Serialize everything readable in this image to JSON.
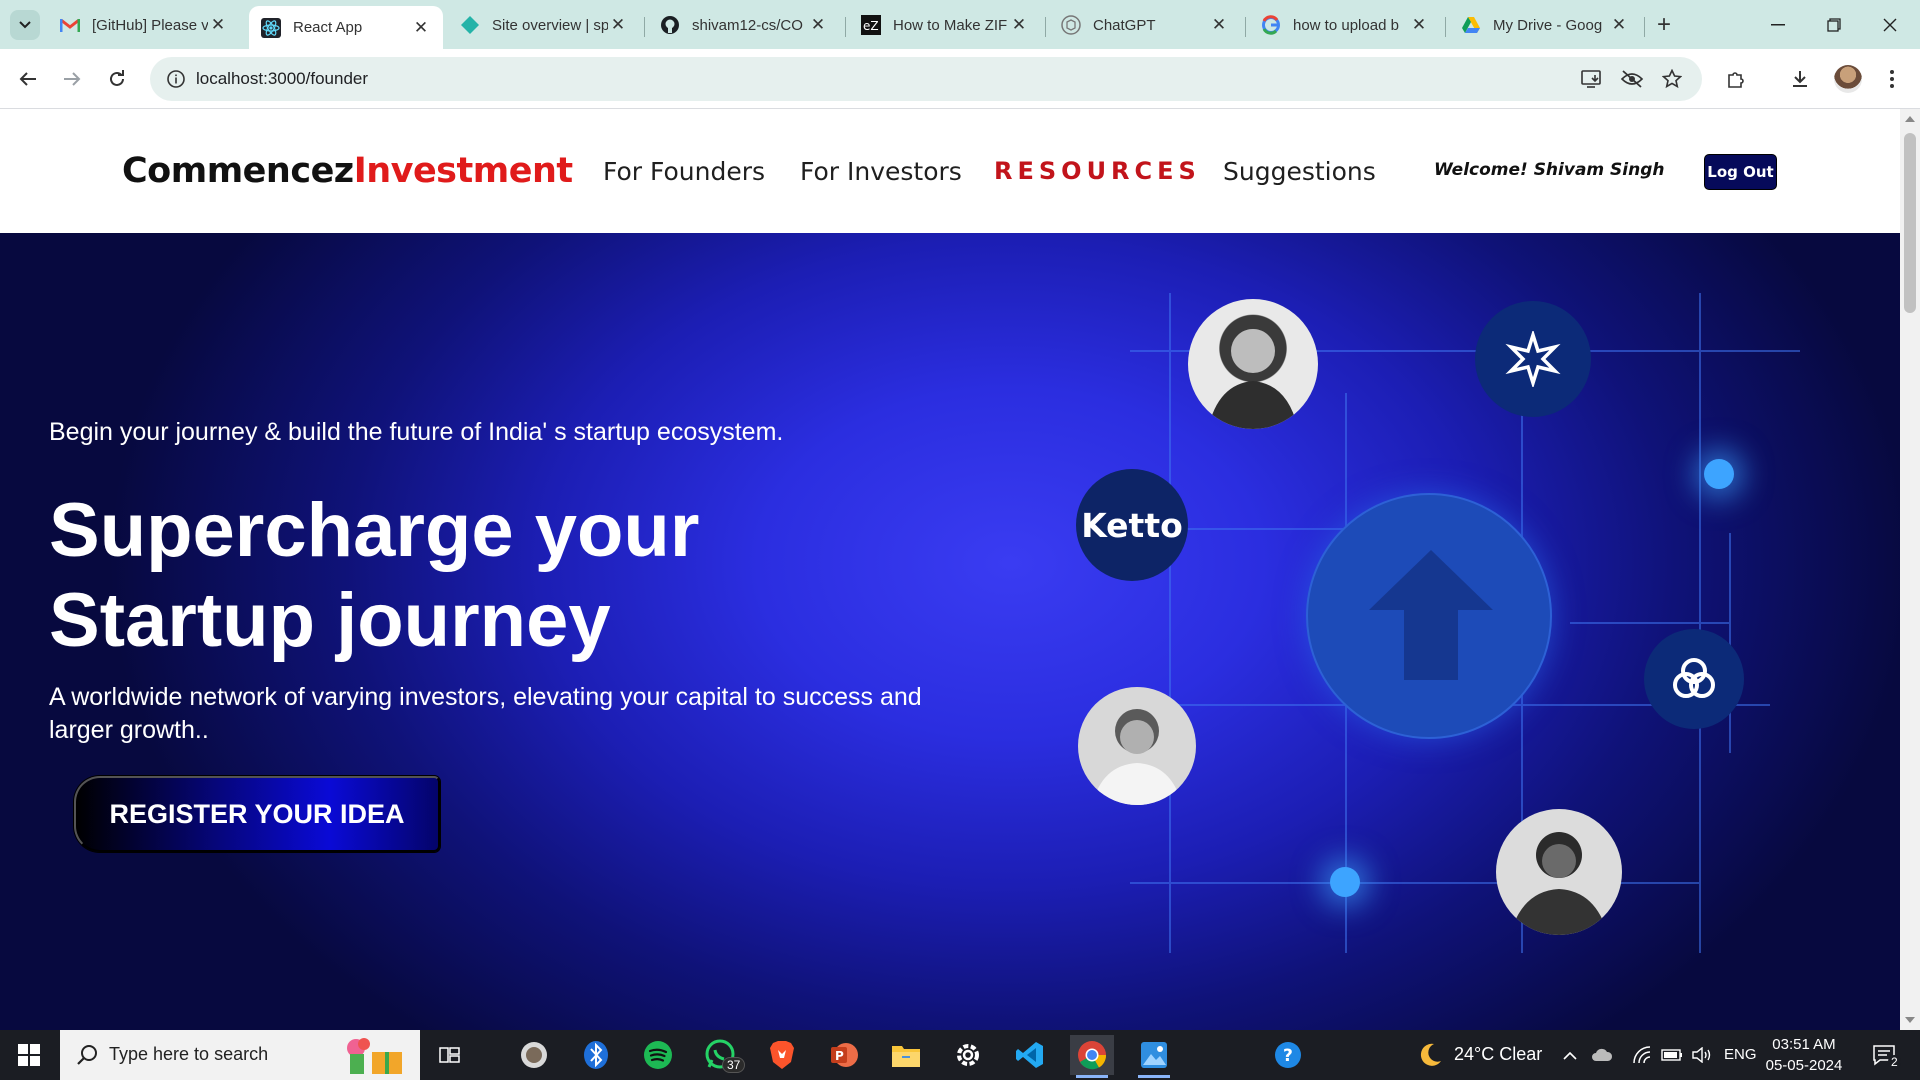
{
  "browser": {
    "tabs": [
      {
        "title": "[GitHub] Please v",
        "icon": "gmail-icon",
        "active": false
      },
      {
        "title": "React App",
        "icon": "react-icon",
        "active": true
      },
      {
        "title": "Site overview | sp",
        "icon": "netlify-icon",
        "active": false
      },
      {
        "title": "shivam12-cs/CO",
        "icon": "github-icon",
        "active": false
      },
      {
        "title": "How to Make ZIF",
        "icon": "ez-icon",
        "active": false
      },
      {
        "title": "ChatGPT",
        "icon": "chatgpt-icon",
        "active": false
      },
      {
        "title": "how to upload b",
        "icon": "google-icon",
        "active": false
      },
      {
        "title": "My Drive - Goog",
        "icon": "drive-icon",
        "active": false
      }
    ],
    "url": "localhost:3000/founder"
  },
  "site": {
    "logo_part1": "Commencez",
    "logo_part2": "Investment",
    "nav": [
      "For Founders",
      "For Investors",
      "RESOURCES",
      "Suggestions"
    ],
    "welcome": "Welcome! Shivam Singh",
    "logout": "Log Out"
  },
  "hero": {
    "tagline": "Begin your journey & build the future of India' s startup ecosystem.",
    "headline_line1": "Supercharge your",
    "headline_line2": "Startup journey",
    "subtext": "A worldwide network of varying investors, elevating your capital to success and larger growth..",
    "cta": "REGISTER YOUR IDEA",
    "ketto_label": "Ketto"
  },
  "taskbar": {
    "search_placeholder": "Type here to search",
    "whatsapp_badge": "37",
    "weather": "24°C  Clear",
    "language": "ENG",
    "time": "03:51 AM",
    "date": "05-05-2024",
    "notifications": "2"
  },
  "colors": {
    "tabstrip": "#cfe8e4",
    "logo_accent": "#e01b1b",
    "resources": "#c2141b",
    "logout_bg": "#060a5a",
    "hero_center": "#3a3cf2",
    "hero_edge": "#07093f"
  }
}
